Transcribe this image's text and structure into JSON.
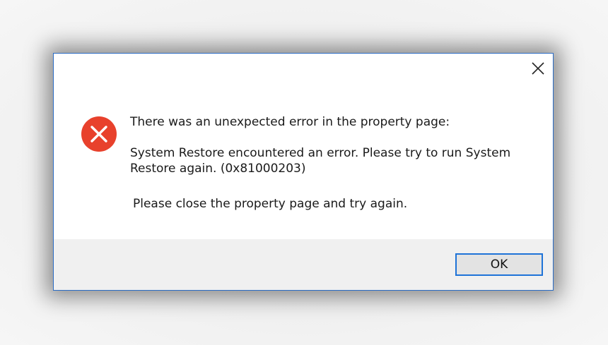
{
  "dialog": {
    "close_icon": "close-icon",
    "error_icon": "error-icon",
    "colors": {
      "error_red": "#e8412c",
      "border_blue": "#2b6cc4",
      "button_focus": "#1e73d8",
      "footer_bg": "#f0f0f0"
    },
    "message": {
      "line1": "There was an unexpected error in the property page:",
      "line2": "System Restore encountered an error. Please try to run System Restore again. (0x81000203)",
      "line3": "Please close the property page and try again."
    },
    "buttons": {
      "ok_label": "OK"
    }
  }
}
